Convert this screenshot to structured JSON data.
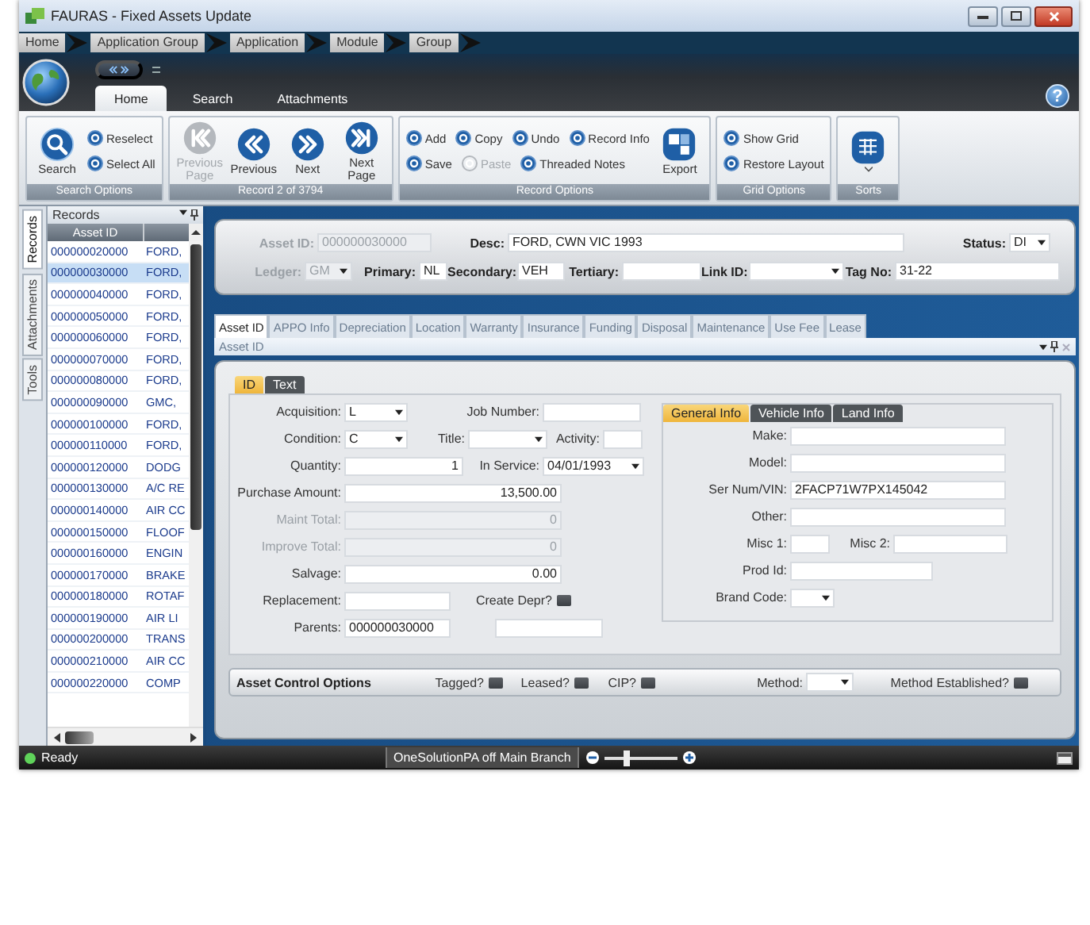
{
  "window": {
    "title": "FAURAS - Fixed Assets Update"
  },
  "breadcrumb": [
    "Home",
    "Application Group",
    "Application",
    "Module",
    "Group"
  ],
  "ribbon_tabs": [
    {
      "label": "Home",
      "selected": true
    },
    {
      "label": "Search",
      "selected": false
    },
    {
      "label": "Attachments",
      "selected": false
    }
  ],
  "help_label": "?",
  "ribbon_groups": [
    {
      "title": "Search Options",
      "items": [
        {
          "kind": "large",
          "label": "Search",
          "disabled": false
        },
        {
          "kind": "stack",
          "rows": [
            [
              {
                "label": "Reselect",
                "disabled": false
              }
            ],
            [
              {
                "label": "Select All",
                "disabled": false
              }
            ]
          ]
        }
      ]
    },
    {
      "title": "Record 2 of 3794",
      "items": [
        {
          "kind": "large",
          "label": "Previous Page",
          "disabled": true
        },
        {
          "kind": "large",
          "label": "Previous",
          "disabled": false
        },
        {
          "kind": "large",
          "label": "Next",
          "disabled": false
        },
        {
          "kind": "large",
          "label": "Next Page",
          "disabled": false
        }
      ]
    },
    {
      "title": "Record Options",
      "items": [
        {
          "kind": "stack",
          "rows": [
            [
              {
                "label": "Add",
                "disabled": false
              },
              {
                "label": "Copy",
                "disabled": false
              },
              {
                "label": "Undo",
                "disabled": false
              },
              {
                "label": "Record Info",
                "disabled": false
              }
            ],
            [
              {
                "label": "Save",
                "disabled": false
              },
              {
                "label": "Paste",
                "disabled": true
              },
              {
                "label": "Threaded Notes",
                "disabled": false
              }
            ]
          ]
        },
        {
          "kind": "large",
          "label": "Export",
          "disabled": false
        }
      ]
    },
    {
      "title": "Grid Options",
      "items": [
        {
          "kind": "stack",
          "rows": [
            [
              {
                "label": "Show Grid",
                "disabled": false
              }
            ],
            [
              {
                "label": "Restore Layout",
                "disabled": false
              }
            ]
          ]
        }
      ]
    },
    {
      "title": "Sorts",
      "items": [
        {
          "kind": "menu",
          "disabled": false
        }
      ]
    }
  ],
  "side_tabs": [
    {
      "label": "Records",
      "selected": true
    },
    {
      "label": "Attachments",
      "selected": false
    },
    {
      "label": "Tools",
      "selected": false
    }
  ],
  "records": {
    "title": "Records",
    "columns": [
      "Asset ID"
    ],
    "rows": [
      {
        "asset_id": "000000020000",
        "column_2": "FORD,",
        "selected": false
      },
      {
        "asset_id": "000000030000",
        "column_2": "FORD,",
        "selected": true
      },
      {
        "asset_id": "000000040000",
        "column_2": "FORD,",
        "selected": false
      },
      {
        "asset_id": "000000050000",
        "column_2": "FORD,",
        "selected": false
      },
      {
        "asset_id": "000000060000",
        "column_2": "FORD,",
        "selected": false
      },
      {
        "asset_id": "000000070000",
        "column_2": "FORD,",
        "selected": false
      },
      {
        "asset_id": "000000080000",
        "column_2": "FORD,",
        "selected": false
      },
      {
        "asset_id": "000000090000",
        "column_2": "GMC,",
        "selected": false
      },
      {
        "asset_id": "000000100000",
        "column_2": "FORD,",
        "selected": false
      },
      {
        "asset_id": "000000110000",
        "column_2": "FORD,",
        "selected": false
      },
      {
        "asset_id": "000000120000",
        "column_2": "DODG",
        "selected": false
      },
      {
        "asset_id": "000000130000",
        "column_2": "A/C RE",
        "selected": false
      },
      {
        "asset_id": "000000140000",
        "column_2": "AIR CC",
        "selected": false
      },
      {
        "asset_id": "000000150000",
        "column_2": "FLOOF",
        "selected": false
      },
      {
        "asset_id": "000000160000",
        "column_2": "ENGIN",
        "selected": false
      },
      {
        "asset_id": "000000170000",
        "column_2": "BRAKE",
        "selected": false
      },
      {
        "asset_id": "000000180000",
        "column_2": "ROTAF",
        "selected": false
      },
      {
        "asset_id": "000000190000",
        "column_2": "AIR LI",
        "selected": false
      },
      {
        "asset_id": "000000200000",
        "column_2": "TRANS",
        "selected": false
      },
      {
        "asset_id": "000000210000",
        "column_2": "AIR CC",
        "selected": false
      },
      {
        "asset_id": "000000220000",
        "column_2": "COMP",
        "selected": false
      }
    ]
  },
  "asset_header": {
    "fields": [
      {
        "label": "Asset ID:",
        "kind": "text",
        "value": "000000030000",
        "disabled": true
      },
      {
        "label": "Desc:",
        "kind": "text",
        "value": "FORD, CWN VIC 1993",
        "disabled": false
      },
      {
        "label": "Status:",
        "kind": "dropdown",
        "value": "DI",
        "disabled": false
      },
      {
        "label": "Ledger:",
        "kind": "dropdown",
        "value": "GM",
        "disabled": true
      },
      {
        "label": "Primary:",
        "kind": "text",
        "value": "NL",
        "disabled": false
      },
      {
        "label": "Secondary:",
        "kind": "text",
        "value": "VEH",
        "disabled": false
      },
      {
        "label": "Tertiary:",
        "kind": "text",
        "disabled": false
      },
      {
        "label": "Link ID:",
        "kind": "dropdown",
        "disabled": false
      },
      {
        "label": "Tag No:",
        "kind": "text",
        "value": "31-22",
        "disabled": false
      }
    ]
  },
  "detail_tabs": [
    {
      "label": "Asset ID",
      "selected": true
    },
    {
      "label": "APPO Info",
      "selected": false
    },
    {
      "label": "Depreciation",
      "selected": false
    },
    {
      "label": "Location",
      "selected": false
    },
    {
      "label": "Warranty",
      "selected": false
    },
    {
      "label": "Insurance",
      "selected": false
    },
    {
      "label": "Funding",
      "selected": false
    },
    {
      "label": "Disposal",
      "selected": false
    },
    {
      "label": "Maintenance",
      "selected": false
    },
    {
      "label": "Use Fee",
      "selected": false
    },
    {
      "label": "Lease",
      "selected": false
    }
  ],
  "detail_title": "Asset ID",
  "form_tabs": [
    {
      "label": "ID",
      "selected": true
    },
    {
      "label": "Text",
      "selected": false
    }
  ],
  "asset_fields": [
    [
      {
        "label": "Acquisition:",
        "kind": "dropdown",
        "value": "L",
        "disabled": false
      },
      {
        "label": "Job Number:",
        "kind": "text",
        "disabled": false
      }
    ],
    [
      {
        "label": "Condition:",
        "kind": "dropdown",
        "value": "C",
        "disabled": false
      },
      {
        "label": "Title:",
        "kind": "dropdown",
        "disabled": false
      },
      {
        "label": "Activity:",
        "kind": "text",
        "disabled": false
      }
    ],
    [
      {
        "label": "Quantity:",
        "kind": "number",
        "value": "1",
        "disabled": false
      },
      {
        "label": "In Service:",
        "kind": "dropdown",
        "value": "04/01/1993",
        "disabled": false
      }
    ],
    [
      {
        "label": "Purchase Amount:",
        "kind": "number",
        "value": "13,500.00",
        "disabled": false
      }
    ],
    [
      {
        "label": "Maint Total:",
        "kind": "number",
        "value": "0",
        "disabled": true
      }
    ],
    [
      {
        "label": "Improve Total:",
        "kind": "number",
        "value": "0",
        "disabled": true
      }
    ],
    [
      {
        "label": "Salvage:",
        "kind": "number",
        "value": "0.00",
        "disabled": false
      }
    ],
    [
      {
        "label": "Replacement:",
        "kind": "text",
        "disabled": false
      },
      {
        "label": "Create Depr?",
        "kind": "checkbox",
        "checked": false,
        "disabled": false
      }
    ],
    [
      {
        "label": "Parents:",
        "kind": "text",
        "value": "000000030000",
        "disabled": false
      },
      {
        "kind": "text",
        "disabled": false
      }
    ]
  ],
  "info_tabs": [
    {
      "label": "General Info",
      "selected": true
    },
    {
      "label": "Vehicle Info",
      "selected": false
    },
    {
      "label": "Land Info",
      "selected": false
    }
  ],
  "info_fields": [
    [
      {
        "label": "Make:",
        "kind": "text",
        "disabled": false
      }
    ],
    [
      {
        "label": "Model:",
        "kind": "text",
        "disabled": false
      }
    ],
    [
      {
        "label": "Ser Num/VIN:",
        "kind": "text",
        "value": "2FACP71W7PX145042",
        "disabled": false
      }
    ],
    [
      {
        "label": "Other:",
        "kind": "text",
        "disabled": false
      }
    ],
    [
      {
        "label": "Misc 1:",
        "kind": "text",
        "disabled": false
      },
      {
        "label": "Misc 2:",
        "kind": "text",
        "disabled": false
      }
    ],
    [
      {
        "label": "Prod Id:",
        "kind": "text",
        "disabled": false
      }
    ],
    [
      {
        "label": "Brand Code:",
        "kind": "dropdown",
        "disabled": false
      }
    ]
  ],
  "control_options": {
    "title": "Asset Control Options",
    "fields": [
      {
        "label": "Tagged?",
        "kind": "checkbox",
        "checked": false,
        "disabled": false
      },
      {
        "label": "Leased?",
        "kind": "checkbox",
        "checked": false,
        "disabled": false
      },
      {
        "label": "CIP?",
        "kind": "checkbox",
        "checked": false,
        "disabled": false
      },
      {
        "label": "Method:",
        "kind": "dropdown",
        "disabled": false
      },
      {
        "label": "Method Established?",
        "kind": "checkbox",
        "checked": false,
        "disabled": false
      }
    ]
  },
  "status_bar": {
    "status": "Ready",
    "connection": "OneSolutionPA off Main Branch",
    "zoom": {
      "level": 0.3
    }
  }
}
